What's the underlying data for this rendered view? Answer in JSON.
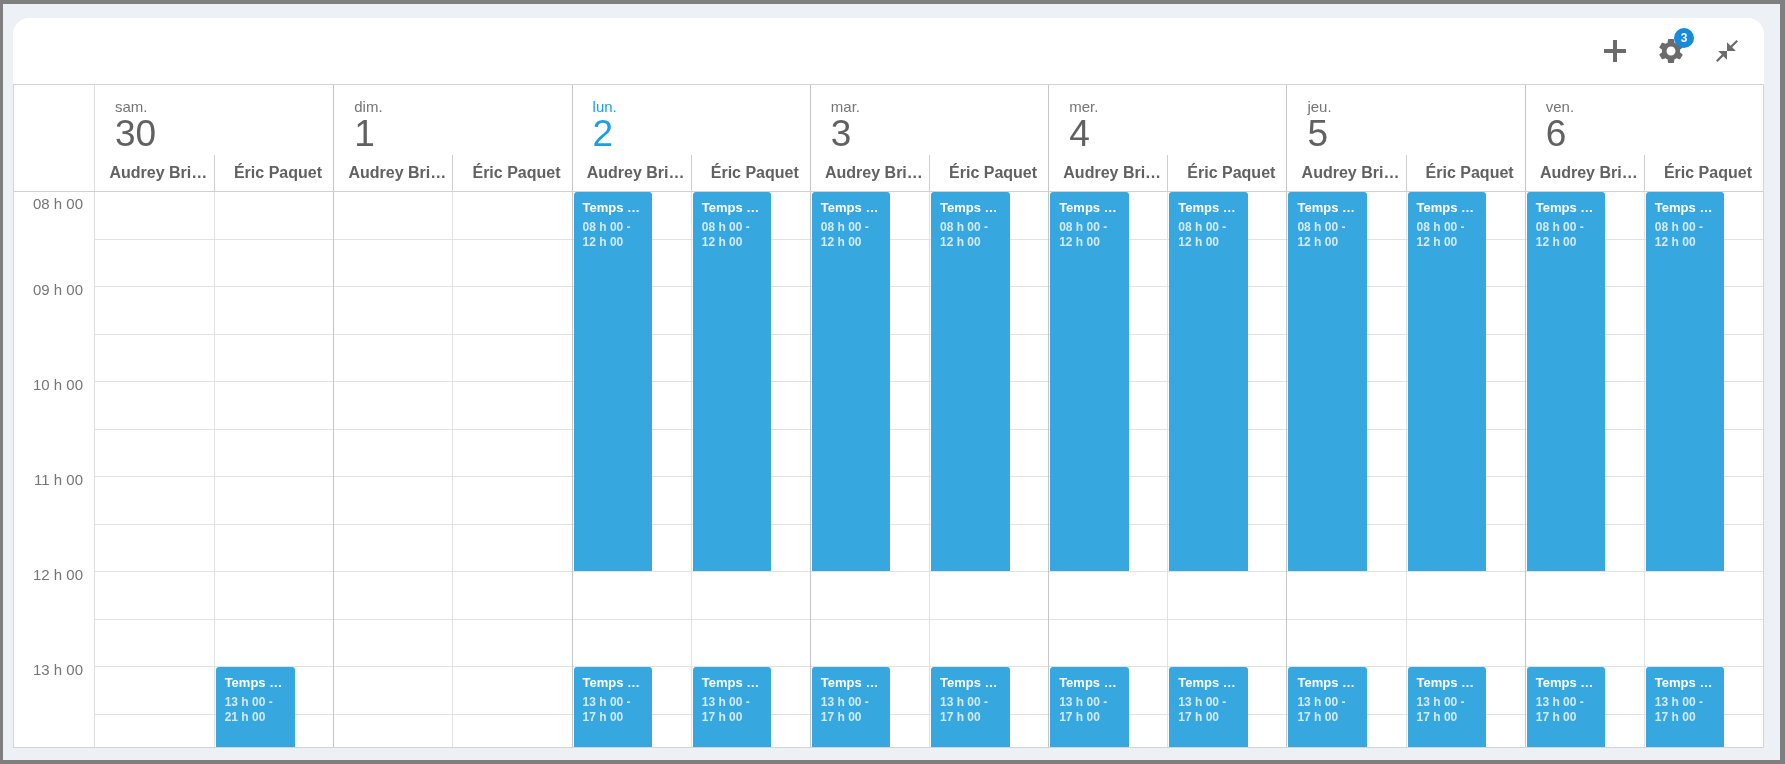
{
  "toolbar": {
    "buttons": [
      {
        "kind": "add"
      },
      {
        "kind": "settings",
        "badge": "3"
      },
      {
        "kind": "collapse"
      }
    ]
  },
  "time_labels": [
    "08 h 00",
    "09 h 00",
    "10 h 00",
    "11 h 00",
    "12 h 00",
    "13 h 00"
  ],
  "days": [
    {
      "weekday": "sam.",
      "date": "30",
      "today": false,
      "resources": [
        {
          "name": "Audrey Bri…"
        },
        {
          "name": "Éric Paquet",
          "events": [
            {
              "kind": "afternoon",
              "title": "Temps …",
              "time": "13 h 00 - 21 h 00"
            }
          ]
        }
      ]
    },
    {
      "weekday": "dim.",
      "date": "1",
      "today": false,
      "resources": [
        {
          "name": "Audrey Bri…"
        },
        {
          "name": "Éric Paquet"
        }
      ]
    },
    {
      "weekday": "lun.",
      "date": "2",
      "today": true,
      "resources": [
        {
          "name": "Audrey Bri…",
          "events": [
            {
              "kind": "morning",
              "title": "Temps …",
              "time": "08 h 00 - 12 h 00"
            },
            {
              "kind": "afternoon",
              "title": "Temps …",
              "time": "13 h 00 - 17 h 00"
            }
          ]
        },
        {
          "name": "Éric Paquet",
          "events": [
            {
              "kind": "morning",
              "title": "Temps …",
              "time": "08 h 00 - 12 h 00"
            },
            {
              "kind": "afternoon",
              "title": "Temps …",
              "time": "13 h 00 - 17 h 00"
            }
          ]
        }
      ]
    },
    {
      "weekday": "mar.",
      "date": "3",
      "today": false,
      "resources": [
        {
          "name": "Audrey Bri…",
          "events": [
            {
              "kind": "morning",
              "title": "Temps …",
              "time": "08 h 00 - 12 h 00"
            },
            {
              "kind": "afternoon",
              "title": "Temps …",
              "time": "13 h 00 - 17 h 00"
            }
          ]
        },
        {
          "name": "Éric Paquet",
          "events": [
            {
              "kind": "morning",
              "title": "Temps …",
              "time": "08 h 00 - 12 h 00"
            },
            {
              "kind": "afternoon",
              "title": "Temps …",
              "time": "13 h 00 - 17 h 00"
            }
          ]
        }
      ]
    },
    {
      "weekday": "mer.",
      "date": "4",
      "today": false,
      "resources": [
        {
          "name": "Audrey Bri…",
          "events": [
            {
              "kind": "morning",
              "title": "Temps …",
              "time": "08 h 00 - 12 h 00"
            },
            {
              "kind": "afternoon",
              "title": "Temps …",
              "time": "13 h 00 - 17 h 00"
            }
          ]
        },
        {
          "name": "Éric Paquet",
          "events": [
            {
              "kind": "morning",
              "title": "Temps …",
              "time": "08 h 00 - 12 h 00"
            },
            {
              "kind": "afternoon",
              "title": "Temps …",
              "time": "13 h 00 - 17 h 00"
            }
          ]
        }
      ]
    },
    {
      "weekday": "jeu.",
      "date": "5",
      "today": false,
      "resources": [
        {
          "name": "Audrey Bri…",
          "events": [
            {
              "kind": "morning",
              "title": "Temps …",
              "time": "08 h 00 - 12 h 00"
            },
            {
              "kind": "afternoon",
              "title": "Temps …",
              "time": "13 h 00 - 17 h 00"
            }
          ]
        },
        {
          "name": "Éric Paquet",
          "events": [
            {
              "kind": "morning",
              "title": "Temps …",
              "time": "08 h 00 - 12 h 00"
            },
            {
              "kind": "afternoon",
              "title": "Temps …",
              "time": "13 h 00 - 17 h 00"
            }
          ]
        }
      ]
    },
    {
      "weekday": "ven.",
      "date": "6",
      "today": false,
      "resources": [
        {
          "name": "Audrey Bri…",
          "events": [
            {
              "kind": "morning",
              "title": "Temps …",
              "time": "08 h 00 - 12 h 00"
            },
            {
              "kind": "afternoon",
              "title": "Temps …",
              "time": "13 h 00 - 17 h 00"
            }
          ]
        },
        {
          "name": "Éric Paquet",
          "events": [
            {
              "kind": "morning",
              "title": "Temps …",
              "time": "08 h 00 - 12 h 00"
            },
            {
              "kind": "afternoon",
              "title": "Temps …",
              "time": "13 h 00 - 17 h 00"
            }
          ]
        }
      ]
    }
  ]
}
